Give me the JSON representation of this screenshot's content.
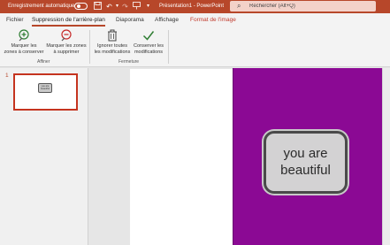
{
  "titlebar": {
    "autosave_label": "Enregistrement automatique",
    "autosave_state": "off",
    "doc_title": "Présentation1 - PowerPoint",
    "search_placeholder": "Rechercher (Alt+Q)",
    "quick_access_icons": [
      "save-icon",
      "undo-icon",
      "redo-icon",
      "present-icon",
      "more-icon"
    ]
  },
  "tabs": [
    {
      "label": "Fichier"
    },
    {
      "label": "Suppression de l'arrière-plan",
      "active": true
    },
    {
      "label": "Diaporama"
    },
    {
      "label": "Affichage"
    },
    {
      "label": "Format de l'image",
      "contextual": true
    }
  ],
  "ribbon": {
    "affiner": {
      "group_label": "Affiner",
      "keep_areas": [
        "Marquer les",
        "zones à conserver"
      ],
      "remove_areas": [
        "Marquer les zones",
        "à supprimer"
      ]
    },
    "fermeture": {
      "group_label": "Fermeture",
      "discard": [
        "Ignorer toutes",
        "les modifications"
      ],
      "keep": [
        "Conserver les",
        "modifications"
      ]
    }
  },
  "thumbnails": {
    "slide_number": "1",
    "mini_text": [
      "you are",
      "beautiful"
    ]
  },
  "canvas": {
    "photo_bg": "#8b0994",
    "badge_line1": "you are",
    "badge_line2": "beautiful"
  },
  "colors": {
    "accent": "#b7472a",
    "contextual_tab": "#c0392b"
  }
}
